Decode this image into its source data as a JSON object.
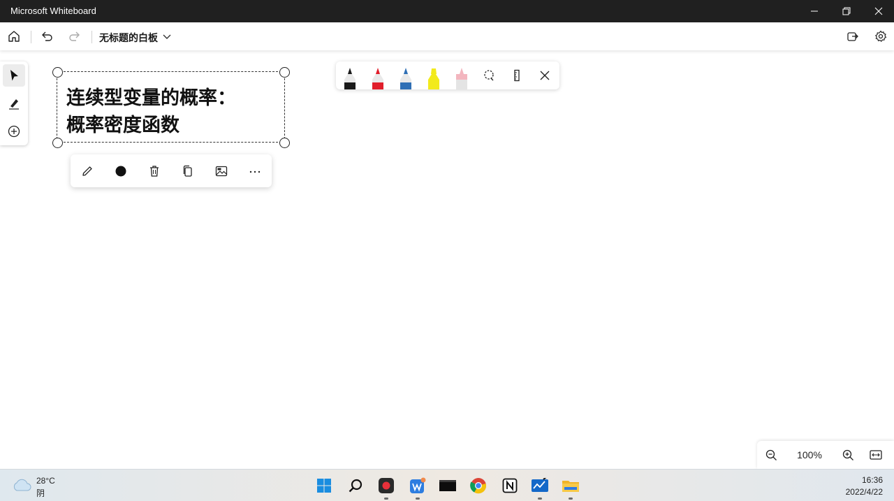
{
  "window": {
    "title": "Microsoft Whiteboard",
    "controls": [
      "minimize-icon",
      "restore-icon",
      "close-icon"
    ]
  },
  "toolbar": {
    "board_title": "无标题的白板",
    "left_icons": [
      "home-icon",
      "undo-icon",
      "redo-icon"
    ],
    "right_icons": [
      "share-icon",
      "settings-icon"
    ]
  },
  "left_rail": {
    "tools": [
      "select-icon",
      "pen-icon",
      "add-icon"
    ],
    "active": "select-icon"
  },
  "pen_tray": {
    "pens": [
      {
        "name": "black-pen",
        "color": "#1a1a1a"
      },
      {
        "name": "red-pen",
        "color": "#e01e2b"
      },
      {
        "name": "blue-pen",
        "color": "#2f6fb5"
      },
      {
        "name": "yellow-highlighter",
        "color": "#f2ea1c"
      },
      {
        "name": "eraser",
        "color": "#f3b6bf"
      }
    ],
    "tools": [
      "lasso-icon",
      "ruler-icon",
      "close-icon"
    ]
  },
  "note": {
    "line1": "连续型变量的概率：",
    "line2": "概率密度函数"
  },
  "context_menu": {
    "items": [
      "edit-icon",
      "color-dot-icon",
      "delete-icon",
      "copy-icon",
      "image-icon",
      "more-icon"
    ]
  },
  "zoom": {
    "level": "100%"
  },
  "taskbar": {
    "weather_temp": "28°C",
    "weather_desc": "阴",
    "time": "16:36",
    "date": "2022/4/22",
    "apps": [
      "windows-start-icon",
      "search-icon",
      "recorder-icon",
      "wps-icon",
      "terminal-icon",
      "chrome-icon",
      "notion-icon",
      "whiteboard-icon",
      "file-explorer-icon"
    ]
  }
}
